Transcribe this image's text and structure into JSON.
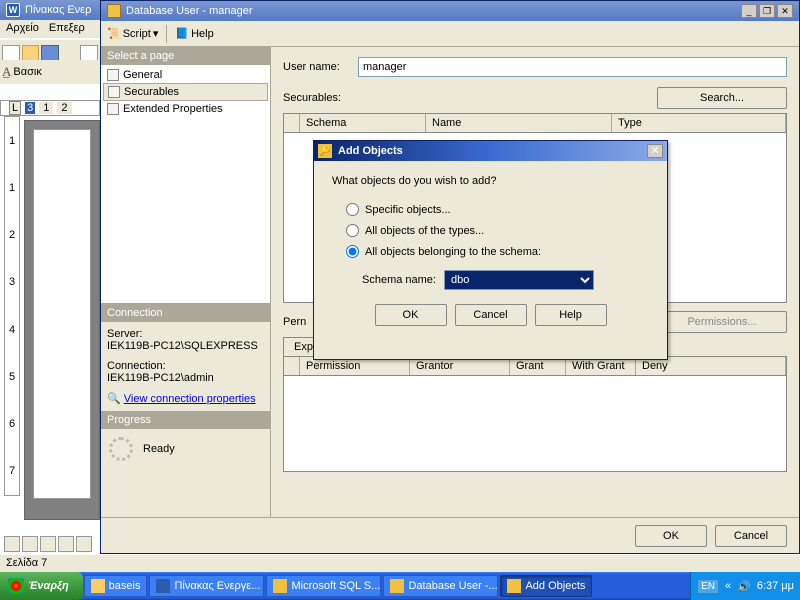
{
  "word": {
    "title": "Πίνακας  Ενερ",
    "menu": [
      "Αρχείο",
      "Επεξερ"
    ],
    "tb2_font": "Βασικ",
    "tb2_aa": "A",
    "ruler_marks": [
      "L",
      "3",
      "1",
      "2"
    ],
    "vruler": [
      "1",
      "1",
      "2",
      "3",
      "4",
      "5",
      "6",
      "7"
    ],
    "status": "Σελίδα 7"
  },
  "ssms": {
    "title": "Database User - manager",
    "toolbar": {
      "script": "Script",
      "help": "Help"
    },
    "select_page_hd": "Select a page",
    "pages": [
      "General",
      "Securables",
      "Extended Properties"
    ],
    "connection_hd": "Connection",
    "server_lbl": "Server:",
    "server_val": "IEK119B-PC12\\SQLEXPRESS",
    "conn_lbl": "Connection:",
    "conn_val": "IEK119B-PC12\\admin",
    "view_props": "View connection properties",
    "progress_hd": "Progress",
    "progress_txt": "Ready",
    "username_lbl": "User name:",
    "username_val": "manager",
    "securables_lbl": "Securables:",
    "search_btn": "Search...",
    "cols1": [
      "Schema",
      "Name",
      "Type"
    ],
    "perm_lbl": "Pern",
    "exp_tab": "Exp",
    "permissions_btn": "Permissions...",
    "cols2": [
      "Permission",
      "Grantor",
      "Grant",
      "With Grant",
      "Deny"
    ],
    "ok": "OK",
    "cancel": "Cancel"
  },
  "dlg": {
    "title": "Add Objects",
    "q": "What objects do you wish to add?",
    "r1": "Specific objects...",
    "r2": "All objects of the types...",
    "r3": "All objects belonging to the schema:",
    "schema_lbl": "Schema name:",
    "schema_val": "dbo",
    "ok": "OK",
    "cancel": "Cancel",
    "help": "Help"
  },
  "taskbar": {
    "start": "Έναρξη",
    "tasks": [
      {
        "label": "baseis",
        "ic": "#fc6"
      },
      {
        "label": "Πίνακας  Ενεργε...",
        "ic": "#2a5dab"
      },
      {
        "label": "Microsoft SQL S...",
        "ic": "#f0c040"
      },
      {
        "label": "Database User -...",
        "ic": "#f0c040"
      },
      {
        "label": "Add Objects     ",
        "ic": "#f0c040",
        "active": true
      }
    ],
    "lang": "EN",
    "arrows": "«",
    "clock": "6:37 μμ"
  }
}
